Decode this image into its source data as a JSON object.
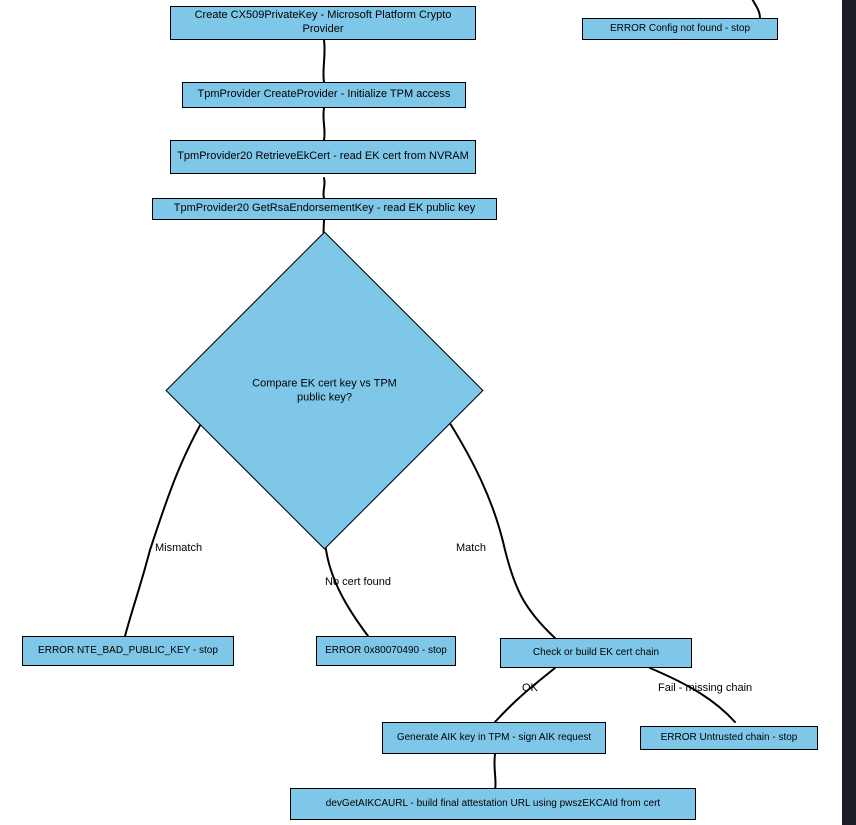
{
  "nodes": {
    "n1": "Create CX509PrivateKey - Microsoft Platform Crypto Provider",
    "n1b": "ERROR Config not found - stop",
    "n2": "TpmProvider CreateProvider - Initialize TPM access",
    "n3": "TpmProvider20 RetrieveEkCert - read EK cert from NVRAM",
    "n4": "TpmProvider20 GetRsaEndorsementKey - read EK public key",
    "d1": "Compare EK cert key vs TPM public key?",
    "e_mismatch": "ERROR NTE_BAD_PUBLIC_KEY - stop",
    "e_nocert": "ERROR 0x80070490 - stop",
    "n5": "Check or build EK cert chain",
    "n6": "Generate AIK key in TPM - sign AIK request",
    "e_untrusted": "ERROR Untrusted chain - stop",
    "n7": "devGetAIKCAURL - build final attestation URL using pwszEKCAId from cert"
  },
  "edges": {
    "mismatch": "Mismatch",
    "nocert": "No cert found",
    "match": "Match",
    "ok": "OK",
    "fail": "Fail - missing chain"
  },
  "chart_data": {
    "type": "flowchart",
    "nodes": [
      {
        "id": "n1",
        "shape": "process",
        "label": "Create CX509PrivateKey - Microsoft Platform Crypto Provider"
      },
      {
        "id": "n1b",
        "shape": "process",
        "label": "ERROR Config not found - stop"
      },
      {
        "id": "n2",
        "shape": "process",
        "label": "TpmProvider CreateProvider - Initialize TPM access"
      },
      {
        "id": "n3",
        "shape": "process",
        "label": "TpmProvider20 RetrieveEkCert - read EK cert from NVRAM"
      },
      {
        "id": "n4",
        "shape": "process",
        "label": "TpmProvider20 GetRsaEndorsementKey - read EK public key"
      },
      {
        "id": "d1",
        "shape": "decision",
        "label": "Compare EK cert key vs TPM public key?"
      },
      {
        "id": "e_mismatch",
        "shape": "process",
        "label": "ERROR NTE_BAD_PUBLIC_KEY - stop"
      },
      {
        "id": "e_nocert",
        "shape": "process",
        "label": "ERROR 0x80070490 - stop"
      },
      {
        "id": "n5",
        "shape": "process",
        "label": "Check or build EK cert chain"
      },
      {
        "id": "n6",
        "shape": "process",
        "label": "Generate AIK key in TPM - sign AIK request"
      },
      {
        "id": "e_untrusted",
        "shape": "process",
        "label": "ERROR Untrusted chain - stop"
      },
      {
        "id": "n7",
        "shape": "process",
        "label": "devGetAIKCAURL - build final attestation URL using pwszEKCAId from cert"
      }
    ],
    "edges": [
      {
        "from": "offscreen",
        "to": "n1"
      },
      {
        "from": "offscreen",
        "to": "n1b"
      },
      {
        "from": "n1",
        "to": "n2"
      },
      {
        "from": "n2",
        "to": "n3"
      },
      {
        "from": "n3",
        "to": "n4"
      },
      {
        "from": "n4",
        "to": "d1"
      },
      {
        "from": "d1",
        "to": "e_mismatch",
        "label": "Mismatch"
      },
      {
        "from": "d1",
        "to": "e_nocert",
        "label": "No cert found"
      },
      {
        "from": "d1",
        "to": "n5",
        "label": "Match"
      },
      {
        "from": "n5",
        "to": "n6",
        "label": "OK"
      },
      {
        "from": "n5",
        "to": "e_untrusted",
        "label": "Fail - missing chain"
      },
      {
        "from": "n6",
        "to": "n7"
      }
    ]
  }
}
